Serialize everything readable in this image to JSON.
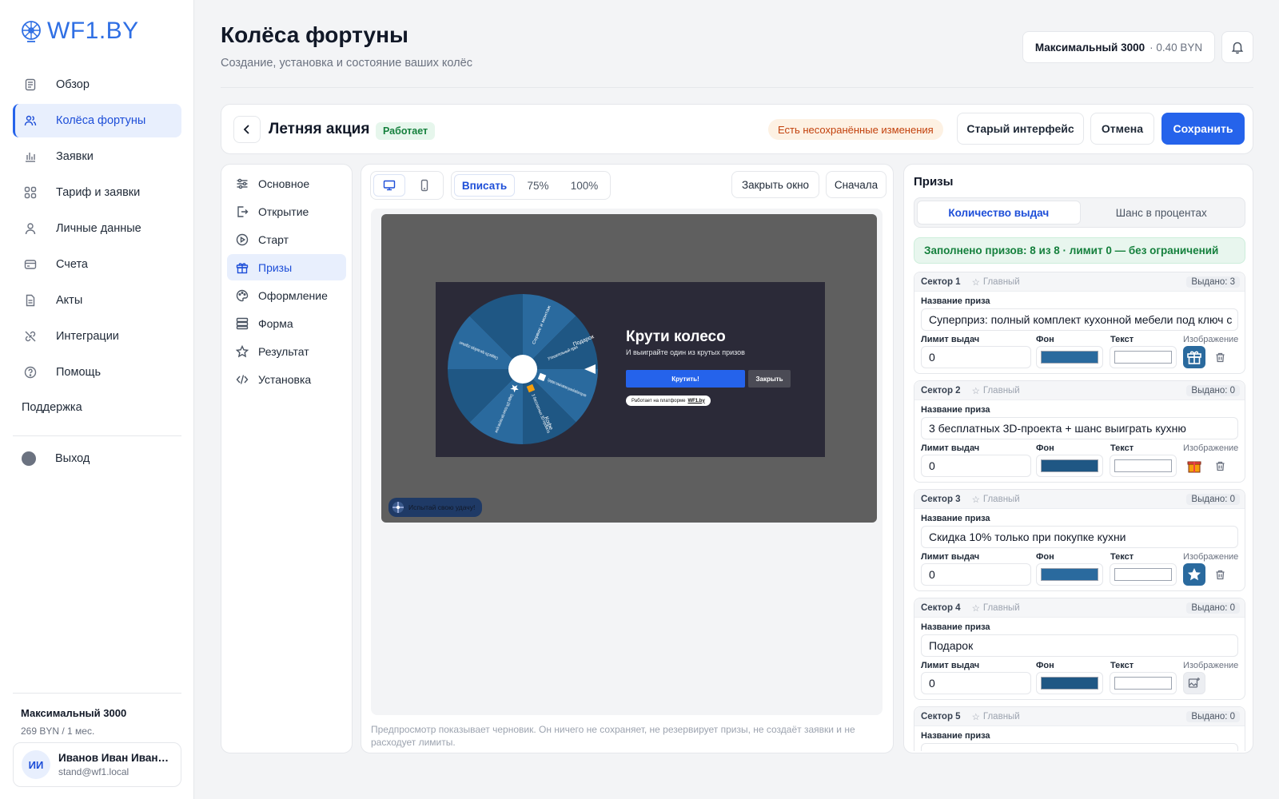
{
  "brand": {
    "name": "WF1.BY"
  },
  "nav": {
    "items": [
      {
        "label": "Обзор",
        "icon": "document-icon"
      },
      {
        "label": "Колёса фортуны",
        "icon": "users-icon"
      },
      {
        "label": "Заявки",
        "icon": "bar-chart-icon"
      },
      {
        "label": "Тариф и заявки",
        "icon": "grid-icon"
      },
      {
        "label": "Личные данные",
        "icon": "user-icon"
      },
      {
        "label": "Счета",
        "icon": "card-icon"
      },
      {
        "label": "Акты",
        "icon": "file-icon"
      },
      {
        "label": "Интеграции",
        "icon": "link-icon"
      },
      {
        "label": "Помощь",
        "icon": "help-icon"
      }
    ],
    "support": "Поддержка",
    "logout": "Выход"
  },
  "plan": {
    "name": "Максимальный 3000",
    "price": "269 BYN / 1 мес."
  },
  "user": {
    "initials": "ИИ",
    "name": "Иванов Иван Иванович",
    "email": "stand@wf1.local"
  },
  "header": {
    "title": "Колёса фортуны",
    "subtitle": "Создание, установка и состояние ваших колёс",
    "balance_plan": "Максимальный 3000",
    "balance_value": "· 0.40 BYN"
  },
  "toolbar": {
    "wheel_name": "Летняя акция",
    "status": "Работает",
    "unsaved": "Есть несохранённые изменения",
    "old_ui": "Старый интерфейс",
    "cancel": "Отмена",
    "save": "Сохранить"
  },
  "settings_menu": [
    {
      "label": "Основное",
      "icon": "sliders-icon"
    },
    {
      "label": "Открытие",
      "icon": "door-icon"
    },
    {
      "label": "Старт",
      "icon": "play-icon"
    },
    {
      "label": "Призы",
      "icon": "gift-icon"
    },
    {
      "label": "Оформление",
      "icon": "palette-icon"
    },
    {
      "label": "Форма",
      "icon": "form-icon"
    },
    {
      "label": "Результат",
      "icon": "star-icon"
    },
    {
      "label": "Установка",
      "icon": "code-icon"
    }
  ],
  "preview": {
    "zoom": [
      "Вписать",
      "75%",
      "100%"
    ],
    "zoom_selected": "Вписать",
    "close_window": "Закрыть окно",
    "restart": "Сначала",
    "modal_title": "Крути колесо",
    "modal_sub": "И выиграйте один из крутых призов",
    "spin": "Крутить!",
    "close": "Закрыть",
    "platform": "Работает на платформе",
    "platform_link": "WF1.by",
    "teaser": "Испытай свою удачу!",
    "note": "Предпросмотр показывает черновик. Он ничего не сохраняет, не резервирует призы, не создаёт заявки и не расходует лимиты."
  },
  "prizes": {
    "title": "Призы",
    "tabs": [
      "Количество выдач",
      "Шанс в процентах"
    ],
    "filled": "Заполнено призов: 8 из 8 · лимит 0 — без ограничений",
    "labels": {
      "name": "Название приза",
      "limit": "Лимит выдач",
      "bg": "Фон",
      "text": "Текст",
      "image": "Изображение",
      "main": "Главный"
    },
    "sectors": [
      {
        "title": "Сектор 1",
        "issued": "Выдано: 3",
        "name": "Суперприз: полный комплект кухонной мебели под ключ с",
        "limit": "0",
        "bg": "#2a6a9e",
        "icon": "gift-icon"
      },
      {
        "title": "Сектор 2",
        "issued": "Выдано: 0",
        "name": "3 бесплатных 3D-проекта + шанс выиграть кухню",
        "limit": "0",
        "bg": "#1f5784",
        "icon": "present-icon"
      },
      {
        "title": "Сектор 3",
        "issued": "Выдано: 0",
        "name": "Скидка 10% только при покупке кухни",
        "limit": "0",
        "bg": "#2a6a9e",
        "icon": "star-icon"
      },
      {
        "title": "Сектор 4",
        "issued": "Выдано: 0",
        "name": "Подарок",
        "limit": "0",
        "bg": "#1f5784",
        "icon": "image-add-icon"
      },
      {
        "title": "Сектор 5",
        "issued": "Выдано: 0",
        "name": "",
        "limit": "",
        "bg": "#2a6a9e",
        "icon": ""
      }
    ]
  },
  "wheel_labels": [
    "Суперприз: полный комплект кухонной мебели под ключ",
    "3 бесплатных 3D-проекта",
    "Скидка 10% только при покупке кухни",
    "Подарок",
    "Скидка 5% при выборе отдельно",
    "Кофе",
    "Сервис и монтаж",
    "Утешительный приз"
  ]
}
